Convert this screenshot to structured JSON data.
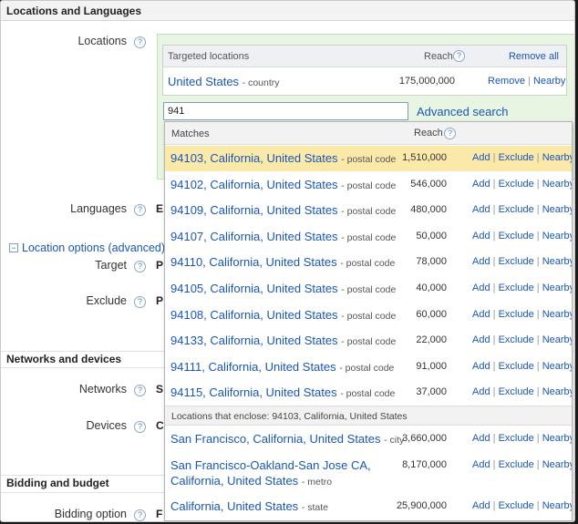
{
  "sections": {
    "locations_languages": "Locations and Languages",
    "networks_devices": "Networks and devices",
    "bidding_budget": "Bidding and budget"
  },
  "labels": {
    "locations": "Locations",
    "languages": "Languages",
    "location_options": "Location options (advanced)",
    "target": "Target",
    "exclude": "Exclude",
    "networks": "Networks",
    "devices": "Devices",
    "bidding_option": "Bidding option",
    "help_icon": "?",
    "collapse_icon": "−"
  },
  "cutoff_values": {
    "languages": "E",
    "target": "P",
    "exclude": "P",
    "networks": "S",
    "devices": "C",
    "bidding_option": "F"
  },
  "targeted": {
    "header_label": "Targeted locations",
    "reach_label": "Reach",
    "remove_all": "Remove all",
    "row_name": "United States",
    "row_type": "- country",
    "row_reach": "175,000,000",
    "remove": "Remove",
    "nearby": "Nearby",
    "separator": "|"
  },
  "search": {
    "value": "941",
    "advanced_search": "Advanced search"
  },
  "dropdown": {
    "matches_label": "Matches",
    "reach_label": "Reach",
    "actions": {
      "add": "Add",
      "exclude": "Exclude",
      "nearby": "Nearby",
      "separator": "|"
    },
    "matches": [
      {
        "name": "94103, California, United States",
        "type": "- postal code",
        "reach": "1,510,000"
      },
      {
        "name": "94102, California, United States",
        "type": "- postal code",
        "reach": "546,000"
      },
      {
        "name": "94109, California, United States",
        "type": "- postal code",
        "reach": "480,000"
      },
      {
        "name": "94107, California, United States",
        "type": "- postal code",
        "reach": "50,000"
      },
      {
        "name": "94110, California, United States",
        "type": "- postal code",
        "reach": "78,000"
      },
      {
        "name": "94105, California, United States",
        "type": "- postal code",
        "reach": "40,000"
      },
      {
        "name": "94108, California, United States",
        "type": "- postal code",
        "reach": "60,000"
      },
      {
        "name": "94133, California, United States",
        "type": "- postal code",
        "reach": "22,000"
      },
      {
        "name": "94111, California, United States",
        "type": "- postal code",
        "reach": "91,000"
      },
      {
        "name": "94115, California, United States",
        "type": "- postal code",
        "reach": "37,000"
      }
    ],
    "enclose_label": "Locations that enclose: 94103, California, United States",
    "enclosing": [
      {
        "name": "San Francisco, California, United States",
        "type": "- city",
        "reach": "3,660,000"
      },
      {
        "name_line1": "San Francisco-Oakland-San Jose CA,",
        "name_line2": "California, United States",
        "type": "- metro",
        "reach": "8,170,000"
      },
      {
        "name": "California, United States",
        "type": "- state",
        "reach": "25,900,000"
      }
    ]
  }
}
